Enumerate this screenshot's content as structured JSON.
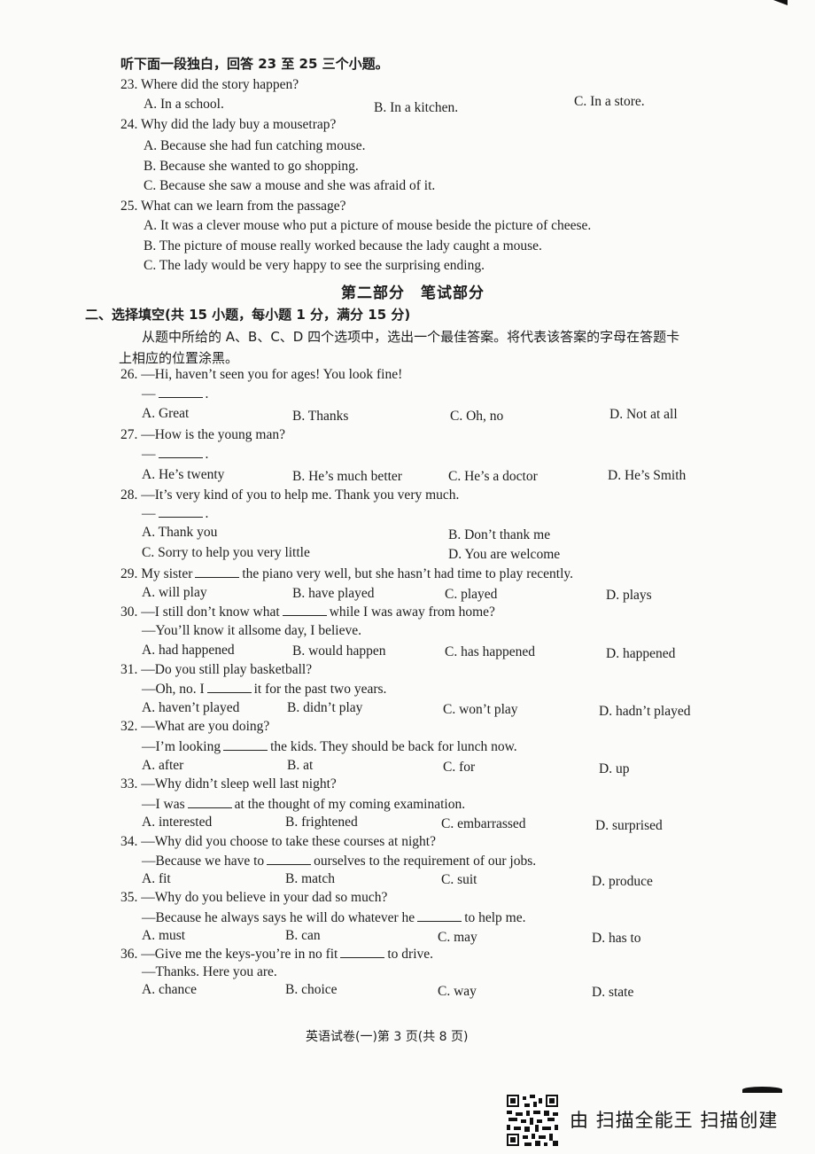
{
  "listening": {
    "instruction": "听下面一段独白，回答 23 至 25 三个小题。",
    "questions": [
      {
        "number": "23.",
        "stem": "Where did the story happen?",
        "options": [
          "A. In a school.",
          "B. In a kitchen.",
          "C. In a store."
        ]
      },
      {
        "number": "24.",
        "stem": "Why did the lady buy a mousetrap?",
        "options": [
          "A. Because she had fun catching mouse.",
          "B. Because she wanted to go shopping.",
          "C. Because she saw a mouse and she was afraid of it."
        ]
      },
      {
        "number": "25.",
        "stem": "What can we learn from the passage?",
        "options": [
          "A. It was a clever mouse who put a picture of mouse beside the picture of cheese.",
          "B. The picture of mouse really worked because the lady caught a mouse.",
          "C. The lady would be very happy to see the surprising ending."
        ]
      }
    ]
  },
  "part_two_title": "第二部分　笔试部分",
  "section_two": {
    "heading": "二、选择填空(共 15 小题，每小题 1 分，满分 15 分)",
    "instruction_line1": "从题中所给的 A、B、C、D 四个选项中，选出一个最佳答案。将代表该答案的字母在答题卡",
    "instruction_line2": "上相应的位置涂黑。",
    "questions": [
      {
        "number": "26.",
        "line1": "—Hi, haven’t seen you for ages! You look fine!",
        "line2_prefix": "—",
        "line2_suffix": ".",
        "options": [
          "A. Great",
          "B. Thanks",
          "C. Oh, no",
          "D. Not at all"
        ]
      },
      {
        "number": "27.",
        "line1": "—How is the young man?",
        "line2_prefix": "—",
        "line2_suffix": ".",
        "options": [
          "A. He’s twenty",
          "B. He’s much better",
          "C. He’s a doctor",
          "D. He’s Smith"
        ]
      },
      {
        "number": "28.",
        "line1": "—It’s very kind of you to help me. Thank you very much.",
        "line2_prefix": "—",
        "line2_suffix": ".",
        "options": [
          "A. Thank you",
          "B. Don’t thank me",
          "C. Sorry to help you very little",
          "D. You are welcome"
        ]
      },
      {
        "number": "29.",
        "line1_before": "My sister",
        "line1_after": "the piano very well, but she hasn’t had time to play recently.",
        "options": [
          "A. will play",
          "B. have played",
          "C. played",
          "D. plays"
        ]
      },
      {
        "number": "30.",
        "line1_before": "—I still don’t know what",
        "line1_after": "while I was away from home?",
        "line2": "—You’ll know it allsome day, I believe.",
        "options": [
          "A. had happened",
          "B. would happen",
          "C. has happened",
          "D. happened"
        ]
      },
      {
        "number": "31.",
        "line1": "—Do you still play basketball?",
        "line2_before": "—Oh, no. I",
        "line2_after": "it for the past two years.",
        "options": [
          "A. haven’t played",
          "B. didn’t play",
          "C. won’t play",
          "D. hadn’t played"
        ]
      },
      {
        "number": "32.",
        "line1": "—What are you doing?",
        "line2_before": "—I’m looking",
        "line2_after": "the kids. They should be back for lunch now.",
        "options": [
          "A. after",
          "B. at",
          "C. for",
          "D. up"
        ]
      },
      {
        "number": "33.",
        "line1": "—Why didn’t sleep well last night?",
        "line2_before": "—I was",
        "line2_after": "at the thought of my coming examination.",
        "options": [
          "A. interested",
          "B. frightened",
          "C. embarrassed",
          "D. surprised"
        ]
      },
      {
        "number": "34.",
        "line1": "—Why did you choose to take these courses at night?",
        "line2_before": "—Because we have to",
        "line2_after": "ourselves to the requirement of our jobs.",
        "options": [
          "A. fit",
          "B. match",
          "C. suit",
          "D. produce"
        ]
      },
      {
        "number": "35.",
        "line1": "—Why do you believe in your dad so much?",
        "line2_before": "—Because he always says he will do whatever he",
        "line2_after": "to help me.",
        "options": [
          "A. must",
          "B. can",
          "C. may",
          "D. has to"
        ]
      },
      {
        "number": "36.",
        "line1_before": "—Give me the keys-you’re in no fit",
        "line1_after": "to drive.",
        "line2": "—Thanks. Here you are.",
        "options": [
          "A. chance",
          "B. choice",
          "C. way",
          "D. state"
        ]
      }
    ]
  },
  "footer": {
    "page_label": "英语试卷(一)第 3 页(共 8 页)"
  },
  "watermark": {
    "qr_icon": "qr-code-icon",
    "text": "由 扫描全能王 扫描创建"
  }
}
